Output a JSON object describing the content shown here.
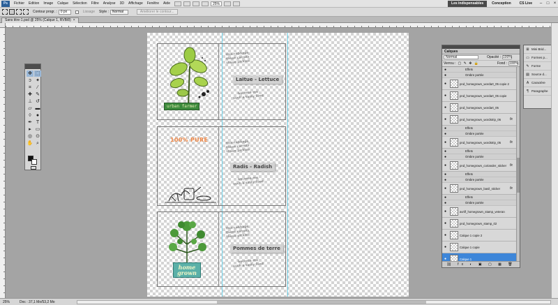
{
  "menubar": {
    "app_badge": "Ps",
    "items": [
      "Fichier",
      "Edition",
      "Image",
      "Calque",
      "Sélection",
      "Filtre",
      "Analyse",
      "3D",
      "Affichage",
      "Fenêtre",
      "Aide"
    ],
    "zoom": "25%",
    "workspace_active": "Les indispensables",
    "workspace_other": "Conception",
    "cs_live": "CS Live"
  },
  "options": {
    "contour_label": "Contour progr. :",
    "contour_value": "0 px",
    "lisse_label": "Lissage",
    "style_label": "Style :",
    "style_value": "Normal",
    "refine_label": "Améliorer le contour..."
  },
  "document": {
    "tab_label": "Sans titre-1.psd @ 25% (Calque 1, RVB/8)",
    "close": "×"
  },
  "cards": [
    {
      "stamp": "this cabbage\nthese carrots\nthese pickles\nbecome me\nsuch a tasty food",
      "label": "Laitue - Lettuce",
      "badge": "urban farmer"
    },
    {
      "pure": "100% PURE",
      "stamp": "this cabbage\nthese carrots\nthese pickles\nbecome me\nsuch a tasty food",
      "label": "Radis - Radish"
    },
    {
      "stamp": "this cabbage\nthese carrots\nthese pickles\nbecome me\nsuch a tasty food",
      "label": "Pommes de terre",
      "badge_line1": "home",
      "badge_line2": "grown"
    }
  ],
  "layers": {
    "tab": "Calques",
    "blend_mode": "Normal",
    "opacity_label": "Opacité :",
    "opacity_value": "100%",
    "lock_label": "Verrou :",
    "fill_label": "Fond :",
    "fill_value": "100%",
    "rows": [
      {
        "kind": "sub",
        "text": "Effets"
      },
      {
        "kind": "sub",
        "text": "Ombre portée"
      },
      {
        "kind": "layer",
        "name": "pnd_homegrown_wordart_05 copie 2",
        "fx": ""
      },
      {
        "kind": "layer",
        "name": "pnd_homegrown_wordart_05 copie",
        "fx": ""
      },
      {
        "kind": "layer",
        "name": "pnd_homegrown_wordart_05",
        "fx": ""
      },
      {
        "kind": "layer",
        "name": "pnd_homegrown_wordstrip_06",
        "fx": "fx"
      },
      {
        "kind": "sub",
        "text": "Effets"
      },
      {
        "kind": "sub",
        "text": "Ombre portée"
      },
      {
        "kind": "layer",
        "name": "pnd_homegrown_wordstrip_05",
        "fx": "fx"
      },
      {
        "kind": "sub",
        "text": "Effets"
      },
      {
        "kind": "sub",
        "text": "Ombre portée"
      },
      {
        "kind": "layer",
        "name": "pnd_homegrown_coriander_sticker",
        "fx": "fx"
      },
      {
        "kind": "sub",
        "text": "Effets"
      },
      {
        "kind": "sub",
        "text": "Ombre portée"
      },
      {
        "kind": "layer",
        "name": "pnd_homegrown_basil_sticker",
        "fx": "fx"
      },
      {
        "kind": "sub",
        "text": "Effets"
      },
      {
        "kind": "sub",
        "text": "Ombre portée"
      },
      {
        "kind": "layer",
        "name": "avrilf_homegrown_stamp_veteran",
        "fx": ""
      },
      {
        "kind": "layer",
        "name": "pnd_homegrown_stamp_02",
        "fx": ""
      },
      {
        "kind": "layer",
        "name": "Calque 1 copie 2",
        "fx": ""
      },
      {
        "kind": "layer",
        "name": "Calque 1 copie",
        "fx": ""
      },
      {
        "kind": "layer",
        "name": "Calque 1",
        "fx": "",
        "selected": true
      }
    ],
    "footer": "⛓ fx ◐ ▣ ▢ ▦ 🗑"
  },
  "minipanel": {
    "items": [
      {
        "icon": "⊞",
        "label": "Mini Brid..."
      },
      {
        "icon": "▭",
        "label": "Formes p..."
      },
      {
        "icon": "✎",
        "label": "Forme"
      },
      {
        "icon": "▤",
        "label": "Source d..."
      },
      {
        "icon": "A",
        "label": "Caractère"
      },
      {
        "icon": "¶",
        "label": "Paragraphe"
      }
    ]
  },
  "status": {
    "zoom": "25%",
    "doc": "Doc : 37,1 Mo/53,2 Mo"
  }
}
